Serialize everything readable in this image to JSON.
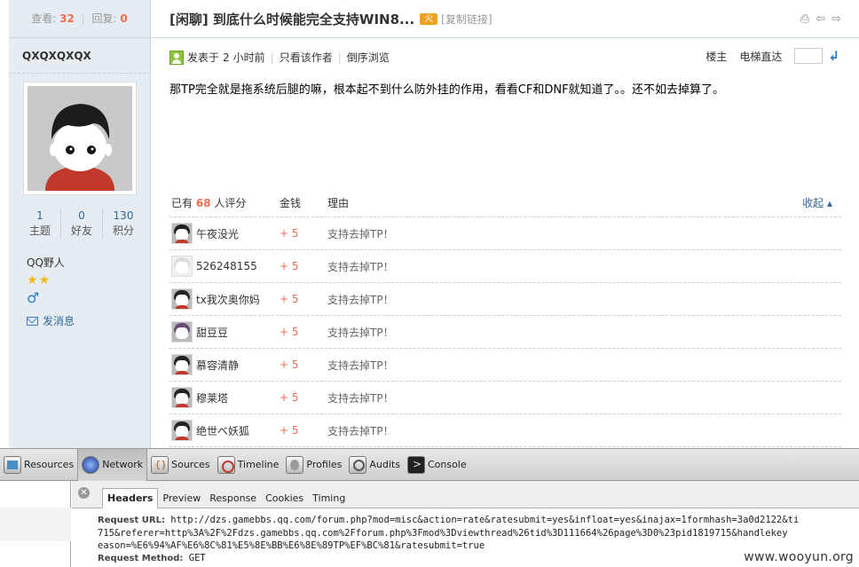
{
  "left_panel": {
    "views_label": "查看:",
    "views": "32",
    "sep": "|",
    "replies_label": "回复:",
    "replies": "0",
    "username": "QXQXQXQX",
    "counts": [
      {
        "value": "1",
        "label": "主题"
      },
      {
        "value": "0",
        "label": "好友"
      },
      {
        "value": "130",
        "label": "积分"
      }
    ],
    "group": "QQ野人",
    "stars": "★★",
    "gender_symbol": "♂",
    "send_message": "发消息"
  },
  "thread": {
    "title": "[闲聊] 到底什么时候能完全支持WIN8...",
    "hot_badge": "火",
    "copy_link": "[复制链接]",
    "tools": [
      "⎙",
      "⇦",
      "⇨"
    ]
  },
  "post": {
    "posted_prefix": "发表于",
    "posted_num": "2",
    "posted_suffix": "小时前",
    "sep": "|",
    "only_author": "只看该作者",
    "reverse": "倒序浏览",
    "floor_owner": "楼主",
    "floor_jump": "电梯直达",
    "go_icon": "↲",
    "body": "那TP完全就是拖系统后腿的嘛，根本起不到什么防外挂的作用，看看CF和DNF就知道了。。还不如去掉算了。"
  },
  "rating": {
    "header_prefix": "已有",
    "count": "68",
    "header_suffix": "人评分",
    "col_money": "金钱",
    "col_reason": "理由",
    "collapse": "收起 ▴",
    "rows": [
      {
        "name": "午夜没光",
        "money": "+ 5",
        "reason": "支持去掉TP！"
      },
      {
        "name": "526248155",
        "money": "+ 5",
        "reason": "支持去掉TP！"
      },
      {
        "name": "tx我次奥你妈",
        "money": "+ 5",
        "reason": "支持去掉TP！"
      },
      {
        "name": "甜豆豆",
        "money": "+ 5",
        "reason": "支持去掉TP！"
      },
      {
        "name": "慕容清静",
        "money": "+ 5",
        "reason": "支持去掉TP！"
      },
      {
        "name": "穆莱塔",
        "money": "+ 5",
        "reason": "支持去掉TP！"
      },
      {
        "name": "绝世べ妖狐",
        "money": "+ 5",
        "reason": "支持去掉TP！"
      }
    ]
  },
  "devtools": {
    "tabs": [
      "Resources",
      "Network",
      "Sources",
      "Timeline",
      "Profiles",
      "Audits",
      "Console"
    ],
    "active_tab": "Network",
    "close_icon": "✕",
    "subtabs": [
      "Headers",
      "Preview",
      "Response",
      "Cookies",
      "Timing"
    ],
    "active_subtab": "Headers",
    "request_url_label": "Request URL:",
    "request_url_line1": "http://dzs.gamebbs.qq.com/forum.php?mod=misc&action=rate&ratesubmit=yes&infloat=yes&inajax=1formhash=3a0d2122&ti",
    "request_url_line2": "715&referer=http%3A%2F%2Fdzs.gamebbs.qq.com%2Fforum.php%3Fmod%3Dviewthread%26tid%3D111664%26page%3D0%23pid1819715&handlekey",
    "request_url_line3": "eason=%E6%94%AF%E6%8C%81%E5%8E%BB%E6%8E%89TP%EF%BC%81&ratesubmit=true",
    "request_method_label": "Request Method:",
    "request_method": "GET"
  },
  "watermark": "www.wooyun.org"
}
